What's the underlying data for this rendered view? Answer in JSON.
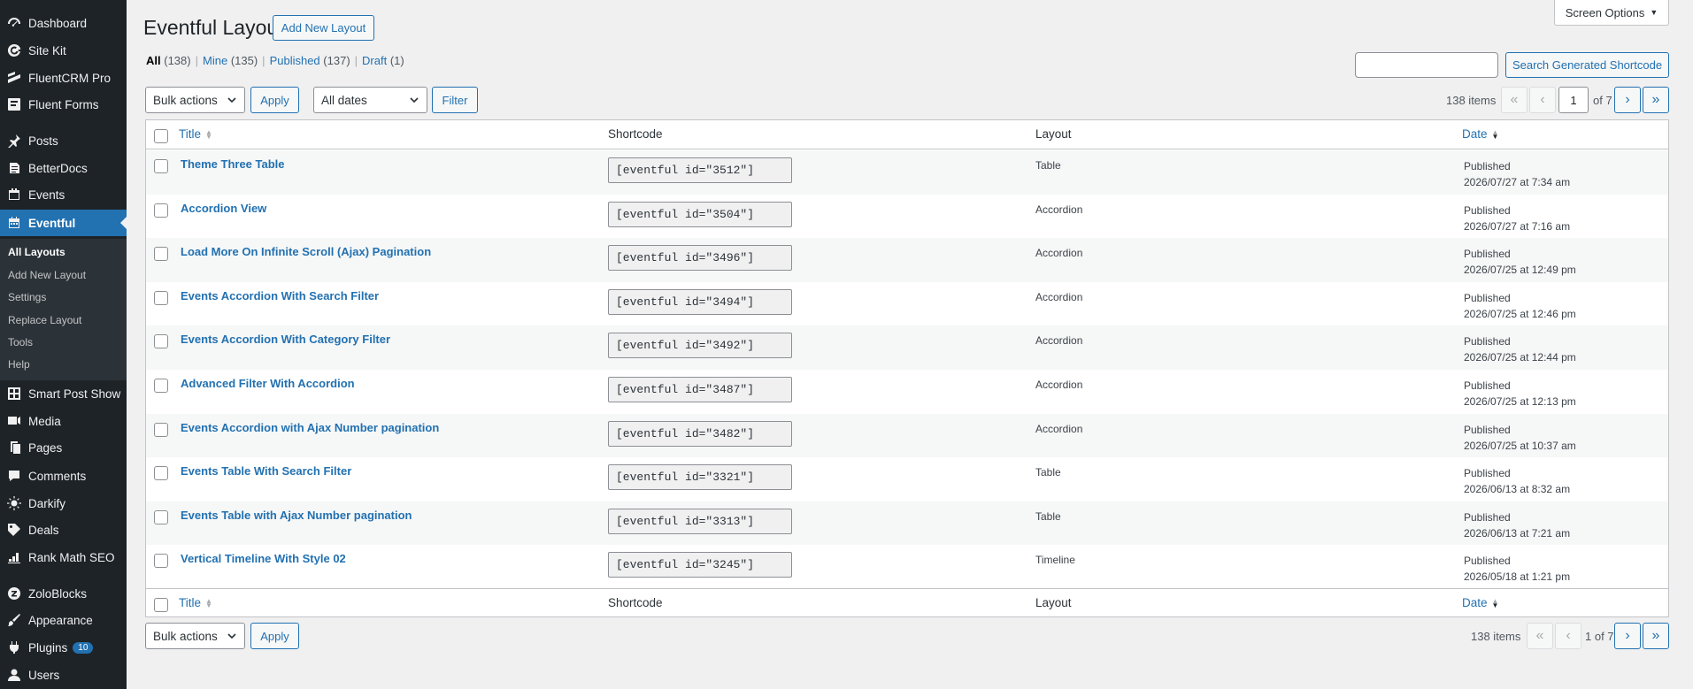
{
  "sidebar": {
    "items": [
      {
        "label": "Dashboard",
        "icon": "dashboard-icon"
      },
      {
        "label": "Site Kit",
        "icon": "google-icon"
      },
      {
        "label": "FluentCRM Pro",
        "icon": "fluentcrm-icon"
      },
      {
        "label": "Fluent Forms",
        "icon": "fluent-forms-icon"
      },
      {
        "label": "Posts",
        "icon": "pin-icon"
      },
      {
        "label": "BetterDocs",
        "icon": "docs-icon"
      },
      {
        "label": "Events",
        "icon": "events-icon"
      },
      {
        "label": "Eventful",
        "icon": "calendar-icon"
      },
      {
        "label": "Smart Post Show",
        "icon": "grid-icon"
      },
      {
        "label": "Media",
        "icon": "media-icon"
      },
      {
        "label": "Pages",
        "icon": "pages-icon"
      },
      {
        "label": "Comments",
        "icon": "comment-icon"
      },
      {
        "label": "Darkify",
        "icon": "sun-icon"
      },
      {
        "label": "Deals",
        "icon": "deals-icon"
      },
      {
        "label": "Rank Math SEO",
        "icon": "chart-icon"
      },
      {
        "label": "ZoloBlocks",
        "icon": "zoloblocks-icon"
      },
      {
        "label": "Appearance",
        "icon": "brush-icon"
      },
      {
        "label": "Plugins",
        "icon": "plugin-icon",
        "badge": "10"
      },
      {
        "label": "Users",
        "icon": "user-icon"
      }
    ],
    "submenu": [
      "All Layouts",
      "Add New Layout",
      "Settings",
      "Replace Layout",
      "Tools",
      "Help"
    ]
  },
  "header": {
    "title": "Eventful Layout",
    "add_new": "Add New Layout",
    "screen_options": "Screen Options"
  },
  "views": [
    {
      "label": "All",
      "count": "(138)"
    },
    {
      "label": "Mine",
      "count": "(135)"
    },
    {
      "label": "Published",
      "count": "(137)"
    },
    {
      "label": "Draft",
      "count": "(1)"
    }
  ],
  "search": {
    "value": "",
    "button": "Search Generated Shortcode"
  },
  "filters": {
    "bulk_actions": "Bulk actions",
    "apply": "Apply",
    "all_dates": "All dates",
    "filter": "Filter"
  },
  "pagination": {
    "items": "138 items",
    "current_page": "1",
    "of_total": "of 7",
    "bottom_text": "1 of 7",
    "first": "«",
    "prev": "‹",
    "next": "›",
    "last": "»"
  },
  "table": {
    "columns": {
      "title": "Title",
      "shortcode": "Shortcode",
      "layout": "Layout",
      "date": "Date"
    },
    "rows": [
      {
        "title": "Theme Three Table",
        "shortcode": "[eventful id=\"3512\"]",
        "layout": "Table",
        "status": "Published",
        "date": "2026/07/27 at 7:34 am"
      },
      {
        "title": "Accordion View",
        "shortcode": "[eventful id=\"3504\"]",
        "layout": "Accordion",
        "status": "Published",
        "date": "2026/07/27 at 7:16 am"
      },
      {
        "title": "Load More On Infinite Scroll (Ajax) Pagination",
        "shortcode": "[eventful id=\"3496\"]",
        "layout": "Accordion",
        "status": "Published",
        "date": "2026/07/25 at 12:49 pm"
      },
      {
        "title": "Events Accordion With Search Filter",
        "shortcode": "[eventful id=\"3494\"]",
        "layout": "Accordion",
        "status": "Published",
        "date": "2026/07/25 at 12:46 pm"
      },
      {
        "title": "Events Accordion With Category Filter",
        "shortcode": "[eventful id=\"3492\"]",
        "layout": "Accordion",
        "status": "Published",
        "date": "2026/07/25 at 12:44 pm"
      },
      {
        "title": "Advanced Filter With Accordion",
        "shortcode": "[eventful id=\"3487\"]",
        "layout": "Accordion",
        "status": "Published",
        "date": "2026/07/25 at 12:13 pm"
      },
      {
        "title": "Events Accordion with Ajax Number pagination",
        "shortcode": "[eventful id=\"3482\"]",
        "layout": "Accordion",
        "status": "Published",
        "date": "2026/07/25 at 10:37 am"
      },
      {
        "title": "Events Table With Search Filter",
        "shortcode": "[eventful id=\"3321\"]",
        "layout": "Table",
        "status": "Published",
        "date": "2026/06/13 at 8:32 am"
      },
      {
        "title": "Events Table with Ajax Number pagination",
        "shortcode": "[eventful id=\"3313\"]",
        "layout": "Table",
        "status": "Published",
        "date": "2026/06/13 at 7:21 am"
      },
      {
        "title": "Vertical Timeline With Style 02",
        "shortcode": "[eventful id=\"3245\"]",
        "layout": "Timeline",
        "status": "Published",
        "date": "2026/05/18 at 1:21 pm"
      }
    ]
  }
}
